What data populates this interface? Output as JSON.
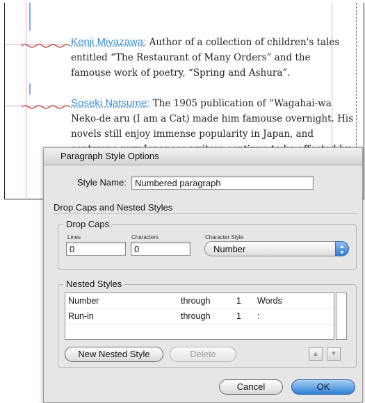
{
  "document": {
    "paragraphs": [
      {
        "run_in": "Kenji Miyazawa:",
        "body": " Author of a collection of children's tales entitled “The Restaurant of Many Orders” and the famouse work of poetry, “Spring and Ashura”."
      },
      {
        "run_in": "Soseki Natsume:",
        "body": " The 1905 publication of “Wagahai-wa Neko-de aru (I am a Cat) made him famouse overnight. His novels still enjoy immense popularity in Japan, and contempo rary Japanese writers continue to be affected by his work."
      }
    ],
    "run_in_color": "#3a8fd0"
  },
  "dialog": {
    "title": "Paragraph Style Options",
    "style_name_label": "Style Name:",
    "style_name_value": "Numbered paragraph",
    "section_title": "Drop Caps and Nested Styles",
    "drop_caps": {
      "group_label": "Drop Caps",
      "lines_label": "Lines",
      "lines_value": "0",
      "characters_label": "Characters",
      "characters_value": "0",
      "char_style_label": "Character Style",
      "char_style_value": "Number"
    },
    "nested_styles": {
      "group_label": "Nested Styles",
      "rows": [
        {
          "style": "Number",
          "through": "through",
          "count": "1",
          "unit": "Words"
        },
        {
          "style": "Run-in",
          "through": "through",
          "count": "1",
          "unit": ":"
        }
      ],
      "new_button": "New Nested Style",
      "delete_button": "Delete",
      "up_icon": "triangle-up-icon",
      "down_icon": "triangle-down-icon"
    },
    "cancel_button": "Cancel",
    "ok_button": "OK",
    "accent_color": "#2f7fd6"
  }
}
